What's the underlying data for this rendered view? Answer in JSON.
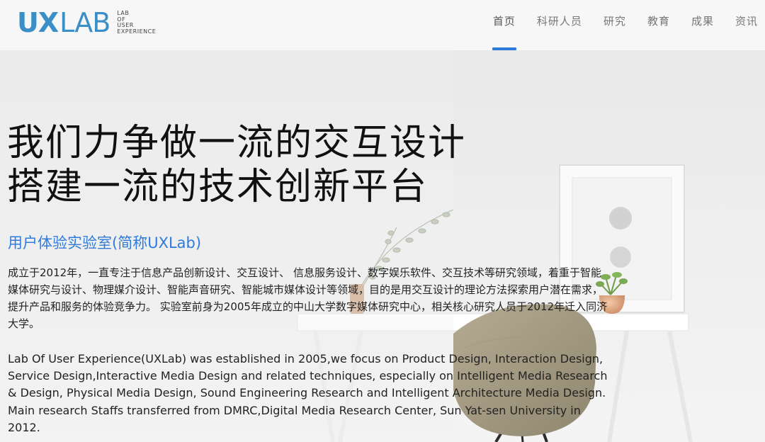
{
  "logo": {
    "ux": "UX",
    "lab": "LAB",
    "sub": [
      "LAB",
      "OF",
      "USER",
      "EXPERIENCE"
    ]
  },
  "nav": {
    "items": [
      {
        "label": "首页",
        "active": true
      },
      {
        "label": "科研人员",
        "active": false
      },
      {
        "label": "研究",
        "active": false
      },
      {
        "label": "教育",
        "active": false
      },
      {
        "label": "成果",
        "active": false
      },
      {
        "label": "资讯",
        "active": false
      }
    ]
  },
  "hero": {
    "headline_line1": "我们力争做一流的交互设计",
    "headline_line2": "搭建一流的技术创新平台",
    "subtitle": "用户体验实验室(简称UXLab)",
    "paragraph_cn": "成立于2012年，一直专注于信息产品创新设计、交互设计、 信息服务设计、数字娱乐软件、交互技术等研究领域，着重于智能媒体研究与设计、物理媒介设计、智能声音研究、智能城市媒体设计等领域，目的是用交互设计的理论方法探索用户潜在需求，提升产品和服务的体验竞争力。 实验室前身为2005年成立的中山大学数字媒体研究中心，相关核心研究人员于2012年迁入同济大学。",
    "paragraph_en": "Lab Of User Experience(UXLab) was established in 2005,we focus on Product Design, Interaction Design, Service Design,Interactive Media Design and related techniques,  especially on Intelligent Media Research & Design,  Physical Media Design,  Sound Engineering Research and Intelligent Architecture Media Design. Main research Staffs transferred from DMRC,Digital Media Research Center, Sun Yat-sen University in 2012."
  },
  "colors": {
    "brand": "#3a8fc6",
    "accent": "#2f7bdc",
    "text": "#111111"
  }
}
